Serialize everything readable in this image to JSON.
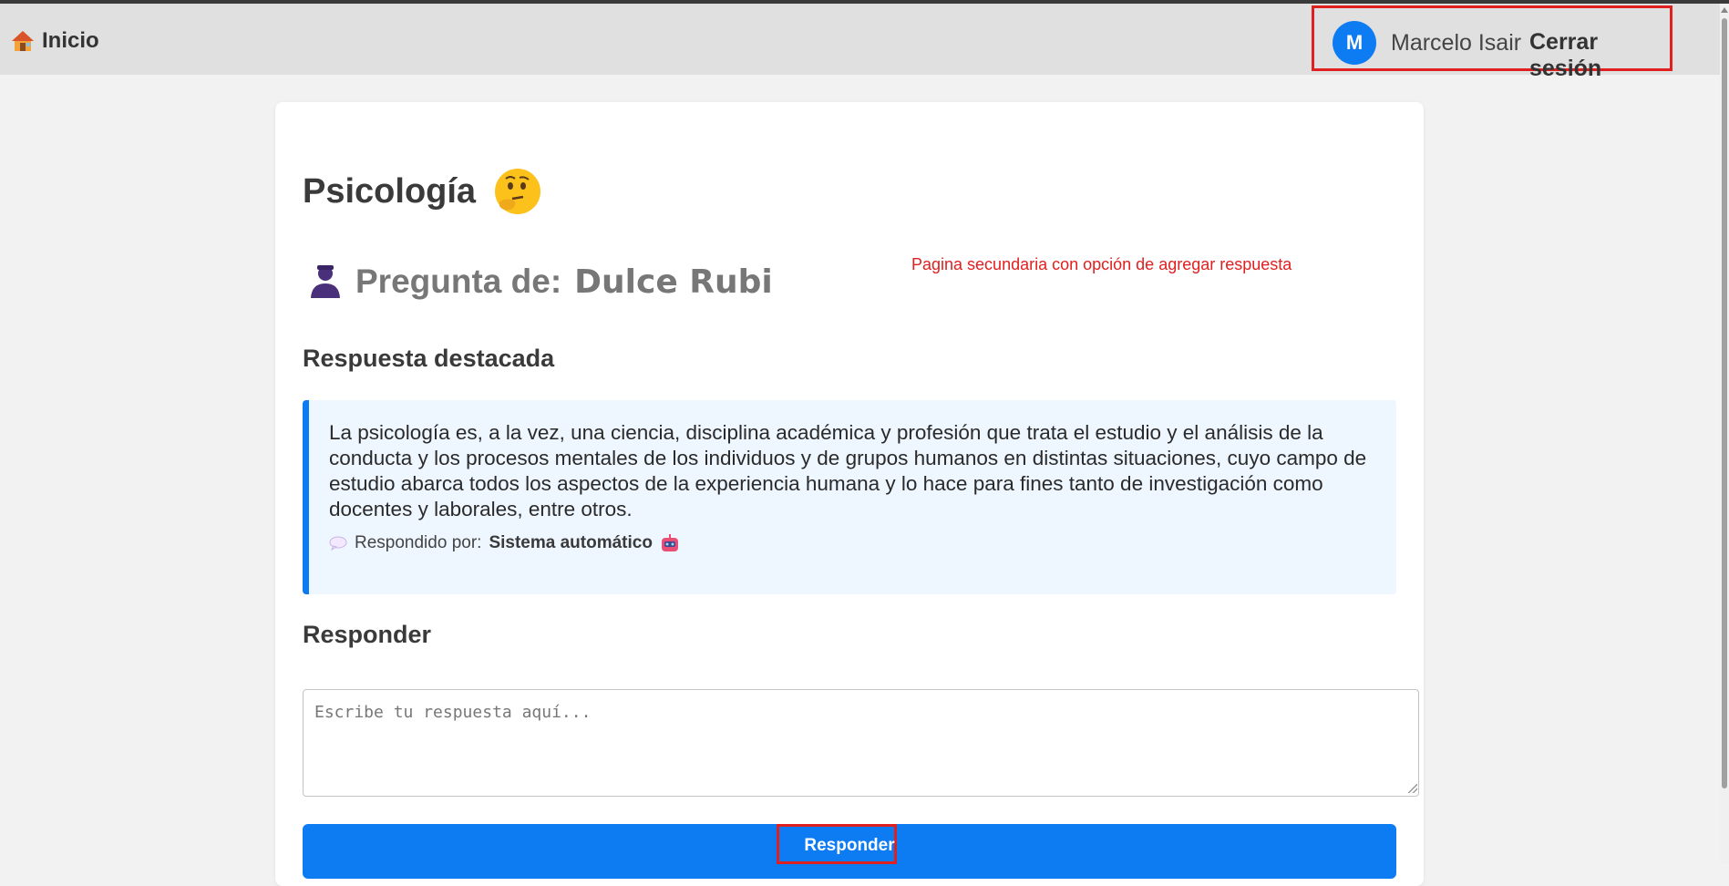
{
  "navbar": {
    "home_label": "Inicio",
    "home_icon": "house-icon",
    "user": {
      "avatar_initial": "M",
      "name": "Marcelo Isair",
      "logout_label": "Cerrar sesión",
      "avatar_color": "#0d7cf2"
    }
  },
  "question": {
    "title": "Psicología",
    "title_icon": "thinking-face-icon",
    "asked_by_prefix": "Pregunta de:",
    "asked_by_name": "Dulce Rubi",
    "asked_by_icon": "person-icon"
  },
  "annotation": {
    "text": "Pagina secundaria con opción de agregar respuesta",
    "color": "#e02020"
  },
  "featured_answer": {
    "heading": "Respuesta destacada",
    "text": "La psicología es, a la vez, una ciencia, disciplina académica y profesión que trata el estudio y el análisis de la conducta y los procesos mentales de los individuos y de grupos humanos en distintas situaciones, cuyo campo de estudio abarca todos los aspectos de la experiencia humana y lo hace para fines tanto de investigación como docentes y laborales, entre otros.",
    "answered_by_prefix": "Respondido por:",
    "answered_by_name": "Sistema automático",
    "accent_color": "#0d7cf2",
    "background_color": "#eef6ff"
  },
  "reply": {
    "heading": "Responder",
    "placeholder": "Escribe tu respuesta aquí...",
    "value": "",
    "submit_label": "Responder",
    "button_color": "#0d7cf2",
    "highlight_color": "#e02020"
  }
}
